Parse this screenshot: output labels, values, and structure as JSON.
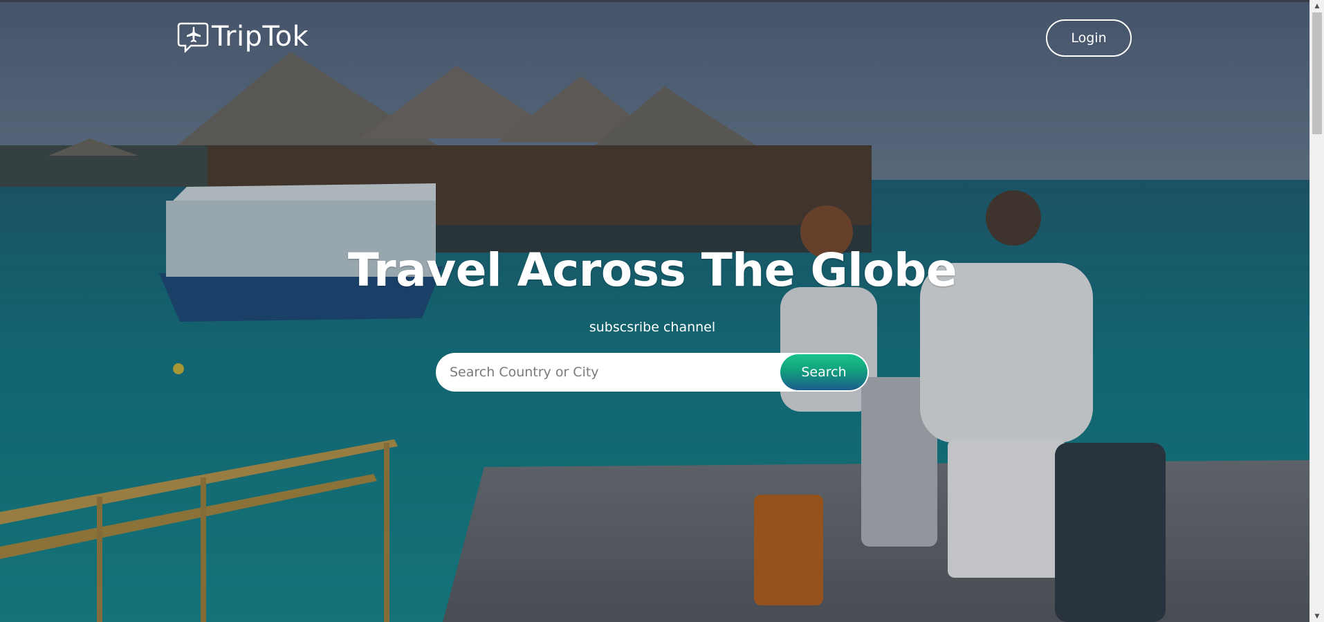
{
  "nav": {
    "brand_name": "TripTok",
    "brand_icon": "plane-chat-bubble-icon",
    "login_label": "Login"
  },
  "hero": {
    "headline": "Travel Across The Globe",
    "subline": "subscsribe channel",
    "background": "tropical-resort-pier-photo"
  },
  "search": {
    "placeholder": "Search Country or City",
    "value": "",
    "button_label": "Search"
  },
  "colors": {
    "text": "#ffffff",
    "search_button_top": "#19c38a",
    "search_button_bottom": "#1d5c8c",
    "water": "#16707a"
  }
}
